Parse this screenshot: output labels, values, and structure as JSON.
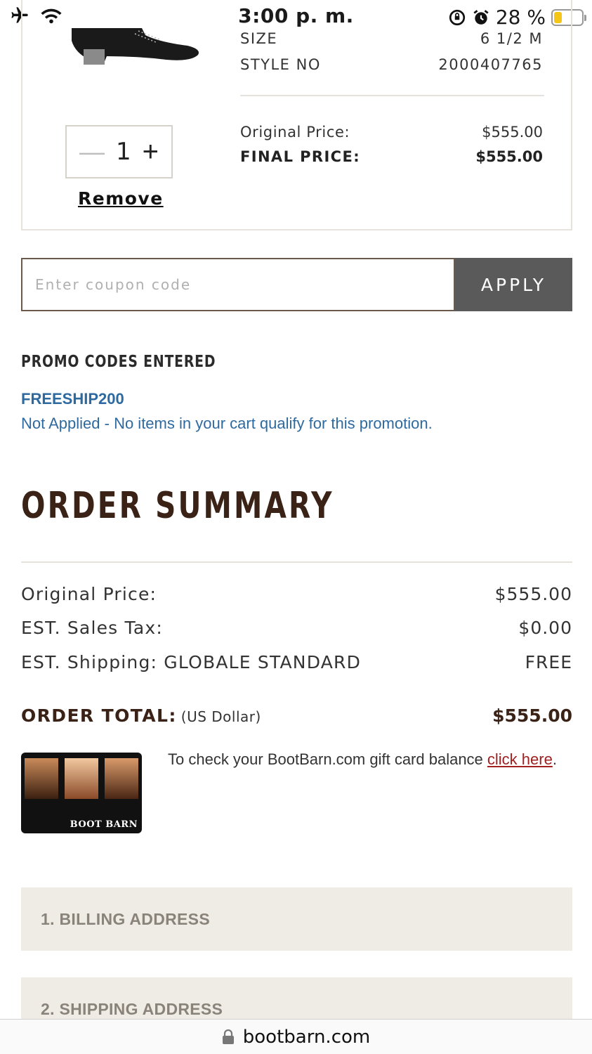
{
  "status_bar": {
    "time": "3:00 p. m.",
    "battery_percent": "28 %",
    "battery_level": 0.28,
    "battery_color": "#f5c518"
  },
  "product": {
    "size_label": "SIZE",
    "size_value": "6 1/2 M",
    "style_label": "STYLE NO",
    "style_value": "2000407765",
    "original_price_label": "Original Price:",
    "original_price_value": "$555.00",
    "final_price_label": "FINAL PRICE:",
    "final_price_value": "$555.00",
    "quantity": "1",
    "remove_label": "Remove"
  },
  "coupon": {
    "placeholder": "Enter coupon code",
    "apply_label": "APPLY"
  },
  "promo": {
    "title": "PROMO CODES ENTERED",
    "code": "FREESHIP200",
    "message": "Not Applied - No items in your cart qualify for this promotion.",
    "color": "#2e6aa0"
  },
  "order_summary": {
    "title": "ORDER SUMMARY",
    "rows": [
      {
        "label": "Original Price:",
        "value": "$555.00"
      },
      {
        "label": "EST. Sales Tax:",
        "value": "$0.00"
      },
      {
        "label": "EST. Shipping: GLOBALE STANDARD",
        "value": "FREE"
      }
    ],
    "total_label": "ORDER TOTAL:",
    "total_currency": "(US Dollar)",
    "total_value": "$555.00"
  },
  "gift_card": {
    "brand": "BOOT BARN",
    "text": "To check your BootBarn.com gift card balance ",
    "link_text": "click here",
    "after_link": "."
  },
  "sections": [
    {
      "label": "1. BILLING ADDRESS"
    },
    {
      "label": "2. SHIPPING ADDRESS"
    }
  ],
  "browser": {
    "url": "bootbarn.com"
  },
  "colors": {
    "brand_brown": "#3a2216",
    "apply_bg": "#5a5a5a",
    "link_red": "#a12020",
    "accordion_bg": "#efece6"
  }
}
